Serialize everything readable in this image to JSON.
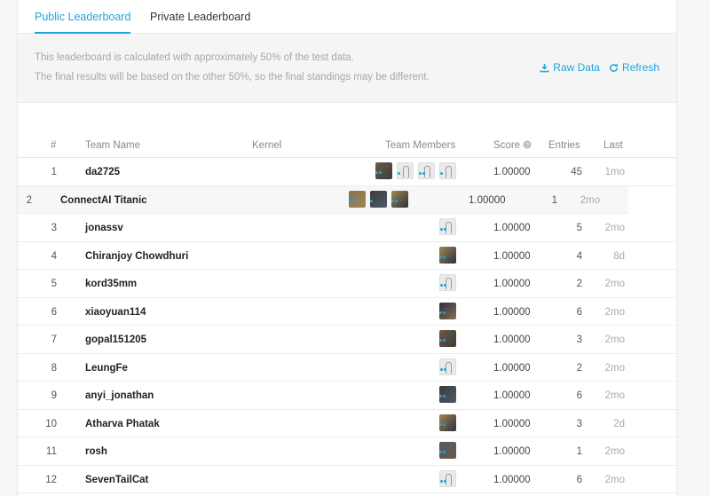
{
  "tabs": {
    "public": "Public Leaderboard",
    "private": "Private Leaderboard"
  },
  "notice": {
    "line1": "This leaderboard is calculated with approximately 50% of the test data.",
    "line2": "The final results will be based on the other 50%, so the final standings may be different.",
    "raw_data": "Raw Data",
    "refresh": "Refresh"
  },
  "columns": {
    "rank": "#",
    "team": "Team Name",
    "kernel": "Kernel",
    "members": "Team Members",
    "score": "Score",
    "entries": "Entries",
    "last": "Last"
  },
  "rows": [
    {
      "rank": "1",
      "team": "da2725",
      "score": "1.00000",
      "entries": "45",
      "last": "1mo",
      "avatars": [
        "photo",
        "default",
        "default",
        "default"
      ]
    },
    {
      "rank": "2",
      "team": "ConnectAI Titanic",
      "score": "1.00000",
      "entries": "1",
      "last": "2mo",
      "avatars": [
        "photo",
        "photo",
        "photo"
      ]
    },
    {
      "rank": "3",
      "team": "jonassv",
      "score": "1.00000",
      "entries": "5",
      "last": "2mo",
      "avatars": [
        "default"
      ]
    },
    {
      "rank": "4",
      "team": "Chiranjoy Chowdhuri",
      "score": "1.00000",
      "entries": "4",
      "last": "8d",
      "avatars": [
        "photo"
      ]
    },
    {
      "rank": "5",
      "team": "kord35mm",
      "score": "1.00000",
      "entries": "2",
      "last": "2mo",
      "avatars": [
        "default"
      ]
    },
    {
      "rank": "6",
      "team": "xiaoyuan114",
      "score": "1.00000",
      "entries": "6",
      "last": "2mo",
      "avatars": [
        "photo"
      ]
    },
    {
      "rank": "7",
      "team": "gopal151205",
      "score": "1.00000",
      "entries": "3",
      "last": "2mo",
      "avatars": [
        "photo"
      ]
    },
    {
      "rank": "8",
      "team": "LeungFe",
      "score": "1.00000",
      "entries": "2",
      "last": "2mo",
      "avatars": [
        "default"
      ]
    },
    {
      "rank": "9",
      "team": "anyi_jonathan",
      "score": "1.00000",
      "entries": "6",
      "last": "2mo",
      "avatars": [
        "photo"
      ]
    },
    {
      "rank": "10",
      "team": "Atharva Phatak",
      "score": "1.00000",
      "entries": "3",
      "last": "2d",
      "avatars": [
        "photo"
      ]
    },
    {
      "rank": "11",
      "team": "rosh",
      "score": "1.00000",
      "entries": "1",
      "last": "2mo",
      "avatars": [
        "photo"
      ]
    },
    {
      "rank": "12",
      "team": "SevenTailCat",
      "score": "1.00000",
      "entries": "6",
      "last": "2mo",
      "avatars": [
        "default"
      ]
    }
  ],
  "colors": {
    "accent": "#20a5d8",
    "photo_palette": [
      "#6b5a4a",
      "#8a6f52",
      "#3b3b3b",
      "#a0884f",
      "#505a6a",
      "#2a3040"
    ]
  }
}
